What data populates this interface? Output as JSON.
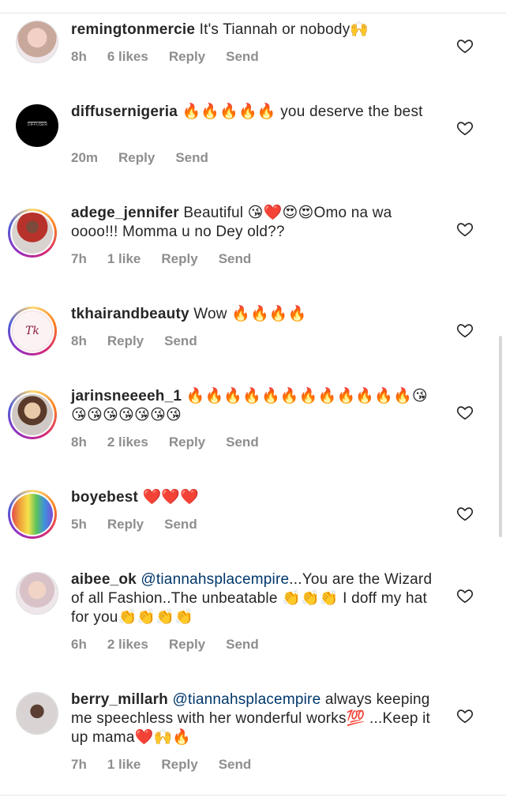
{
  "comments": [
    {
      "username": "remingtonmercie",
      "text": "It's Tiannah or nobody🙌",
      "time": "8h",
      "likes": "6 likes",
      "reply": "Reply",
      "send": "Send"
    },
    {
      "username": "diffusernigeria",
      "text": "🔥🔥🔥🔥🔥 you deserve the best",
      "time": "20m",
      "likes": "",
      "reply": "Reply",
      "send": "Send"
    },
    {
      "username": "adege_jennifer",
      "text": "Beautiful 😘❤️😍😍Omo na wa oooo!!! Momma u no Dey old??",
      "time": "7h",
      "likes": "1 like",
      "reply": "Reply",
      "send": "Send"
    },
    {
      "username": "tkhairandbeauty",
      "text": "Wow 🔥🔥🔥🔥",
      "time": "8h",
      "likes": "",
      "reply": "Reply",
      "send": "Send"
    },
    {
      "username": "jarinsneeeeh_1",
      "text": "🔥🔥🔥🔥🔥🔥🔥🔥🔥🔥🔥🔥😘😘😘😘😘😘😘😘",
      "time": "8h",
      "likes": "2 likes",
      "reply": "Reply",
      "send": "Send"
    },
    {
      "username": "boyebest",
      "text": "❤️❤️❤️",
      "time": "5h",
      "likes": "",
      "reply": "Reply",
      "send": "Send"
    },
    {
      "username": "aibee_ok",
      "mention": "@tiannahsplacempire",
      "text": "...You are the Wizard of all Fashion..The unbeatable 👏👏👏 I doff my hat for you👏👏👏👏",
      "time": "6h",
      "likes": "2 likes",
      "reply": "Reply",
      "send": "Send"
    },
    {
      "username": "berry_millarh",
      "mention": "@tiannahsplacempire",
      "text": "always keeping me speechless with her wonderful works💯 ...Keep it up mama❤️🙌🔥",
      "time": "7h",
      "likes": "1 like",
      "reply": "Reply",
      "send": "Send"
    }
  ],
  "colors": {
    "username": "#262626",
    "meta": "#8e8e8e",
    "mention": "#00376b"
  },
  "icons": {
    "like": "heart-outline-icon"
  }
}
